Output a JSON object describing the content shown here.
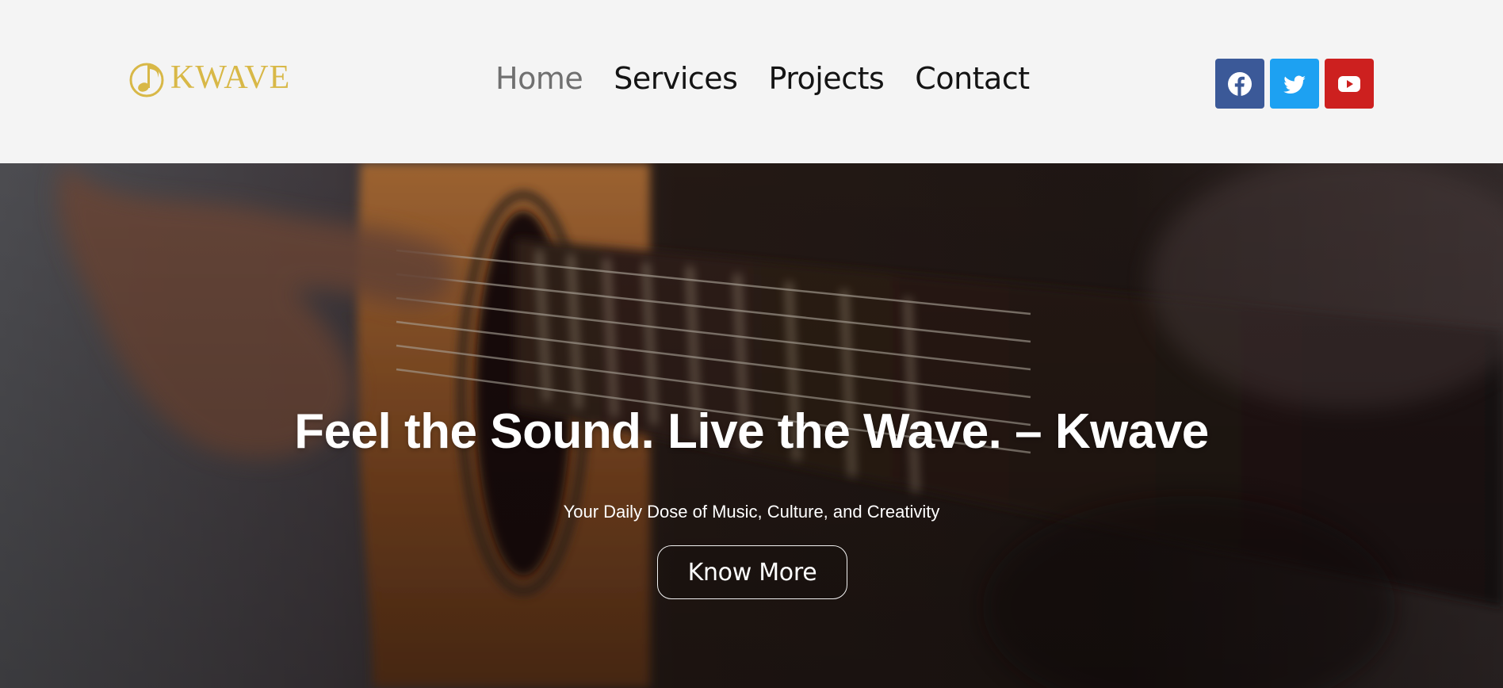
{
  "brand": {
    "name": "KWAVE",
    "color": "#d8b847"
  },
  "nav": {
    "items": [
      {
        "label": "Home",
        "active": true
      },
      {
        "label": "Services",
        "active": false
      },
      {
        "label": "Projects",
        "active": false
      },
      {
        "label": "Contact",
        "active": false
      }
    ]
  },
  "social": [
    {
      "icon": "facebook-icon",
      "color": "#3b5998"
    },
    {
      "icon": "twitter-icon",
      "color": "#1da1f2"
    },
    {
      "icon": "youtube-icon",
      "color": "#cd201f"
    }
  ],
  "hero": {
    "title": "Feel the Sound. Live the Wave. – Kwave",
    "subtitle": "Your Daily Dose of Music, Culture, and Creativity",
    "cta_label": "Know More"
  }
}
